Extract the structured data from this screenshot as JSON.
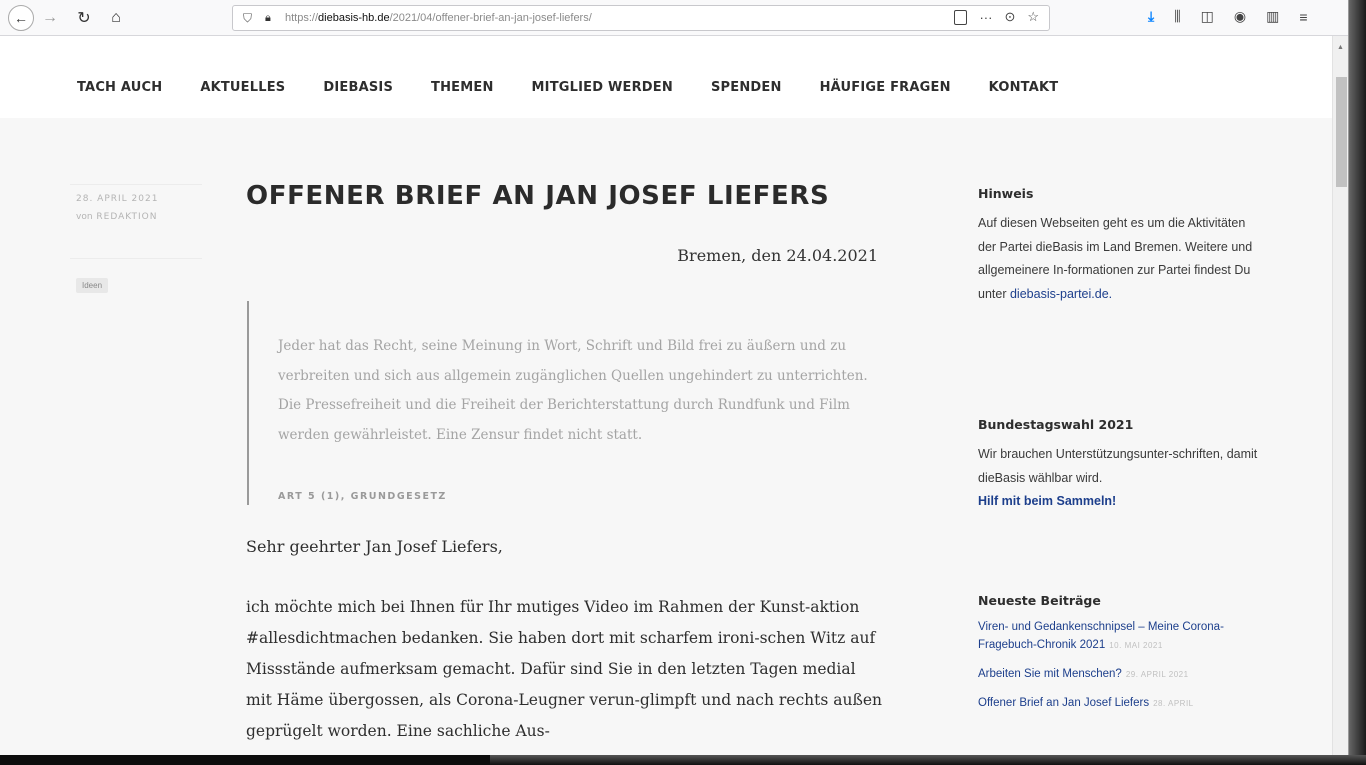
{
  "browser": {
    "url_prefix": "https://",
    "url_domain": "diebasis-hb.de",
    "url_path": "/2021/04/offener-brief-an-jan-josef-liefers/"
  },
  "nav": {
    "items": [
      "TACH AUCH",
      "AKTUELLES",
      "DIEBASIS",
      "THEMEN",
      "MITGLIED WERDEN",
      "SPENDEN",
      "HÄUFIGE FRAGEN",
      "KONTAKT"
    ]
  },
  "post_meta": {
    "date": "28. APRIL 2021",
    "author_prefix": "von",
    "author": "REDAKTION",
    "tag": "Ideen"
  },
  "article": {
    "title": "OFFENER BRIEF AN JAN JOSEF LIEFERS",
    "dateline": "Bremen, den 24.04.2021",
    "quote": "Jeder hat das Recht, seine Meinung in Wort, Schrift und Bild frei zu äußern und zu verbreiten und sich aus allgemein zugänglichen Quellen ungehindert zu unterrichten. Die Pressefreiheit und die Freiheit der Berichterstattung durch Rundfunk und Film werden gewährleistet. Eine Zensur findet nicht statt.",
    "quote_cite": "ART 5 (1), GRUNDGESETZ",
    "salutation": "Sehr geehrter Jan Josef Liefers,",
    "body": "ich möchte mich bei Ihnen für Ihr mutiges Video im Rahmen der Kunst-aktion #allesdichtmachen bedanken. Sie haben dort mit scharfem ironi-schen Witz auf Missstände aufmerksam gemacht. Dafür sind Sie in den letzten Tagen medial mit Häme übergossen, als Corona-Leugner verun-glimpft und nach rechts außen geprügelt worden. Eine sachliche Aus-"
  },
  "sidebar": {
    "hinweis_title": "Hinweis",
    "hinweis_text": "Auf diesen Webseiten geht es um die Aktivitäten der Partei dieBasis im Land Bremen. Weitere und allgemeinere In-formationen zur Partei findest Du unter",
    "hinweis_link": "diebasis-partei.de.",
    "wahl_title": "Bundestagswahl 2021",
    "wahl_text": "Wir brauchen Unterstützungsunter-schriften, damit dieBasis wählbar wird.",
    "wahl_link": "Hilf mit beim Sammeln!",
    "posts_title": "Neueste Beiträge",
    "posts": [
      {
        "title": "Viren- und Gedankenschnipsel – Meine Corona-Fragebuch-Chronik 2021",
        "date": "10. MAI 2021"
      },
      {
        "title": "Arbeiten Sie mit Menschen?",
        "date": "29. APRIL 2021"
      },
      {
        "title": "Offener Brief an Jan Josef Liefers",
        "date": "28. APRIL"
      }
    ]
  }
}
